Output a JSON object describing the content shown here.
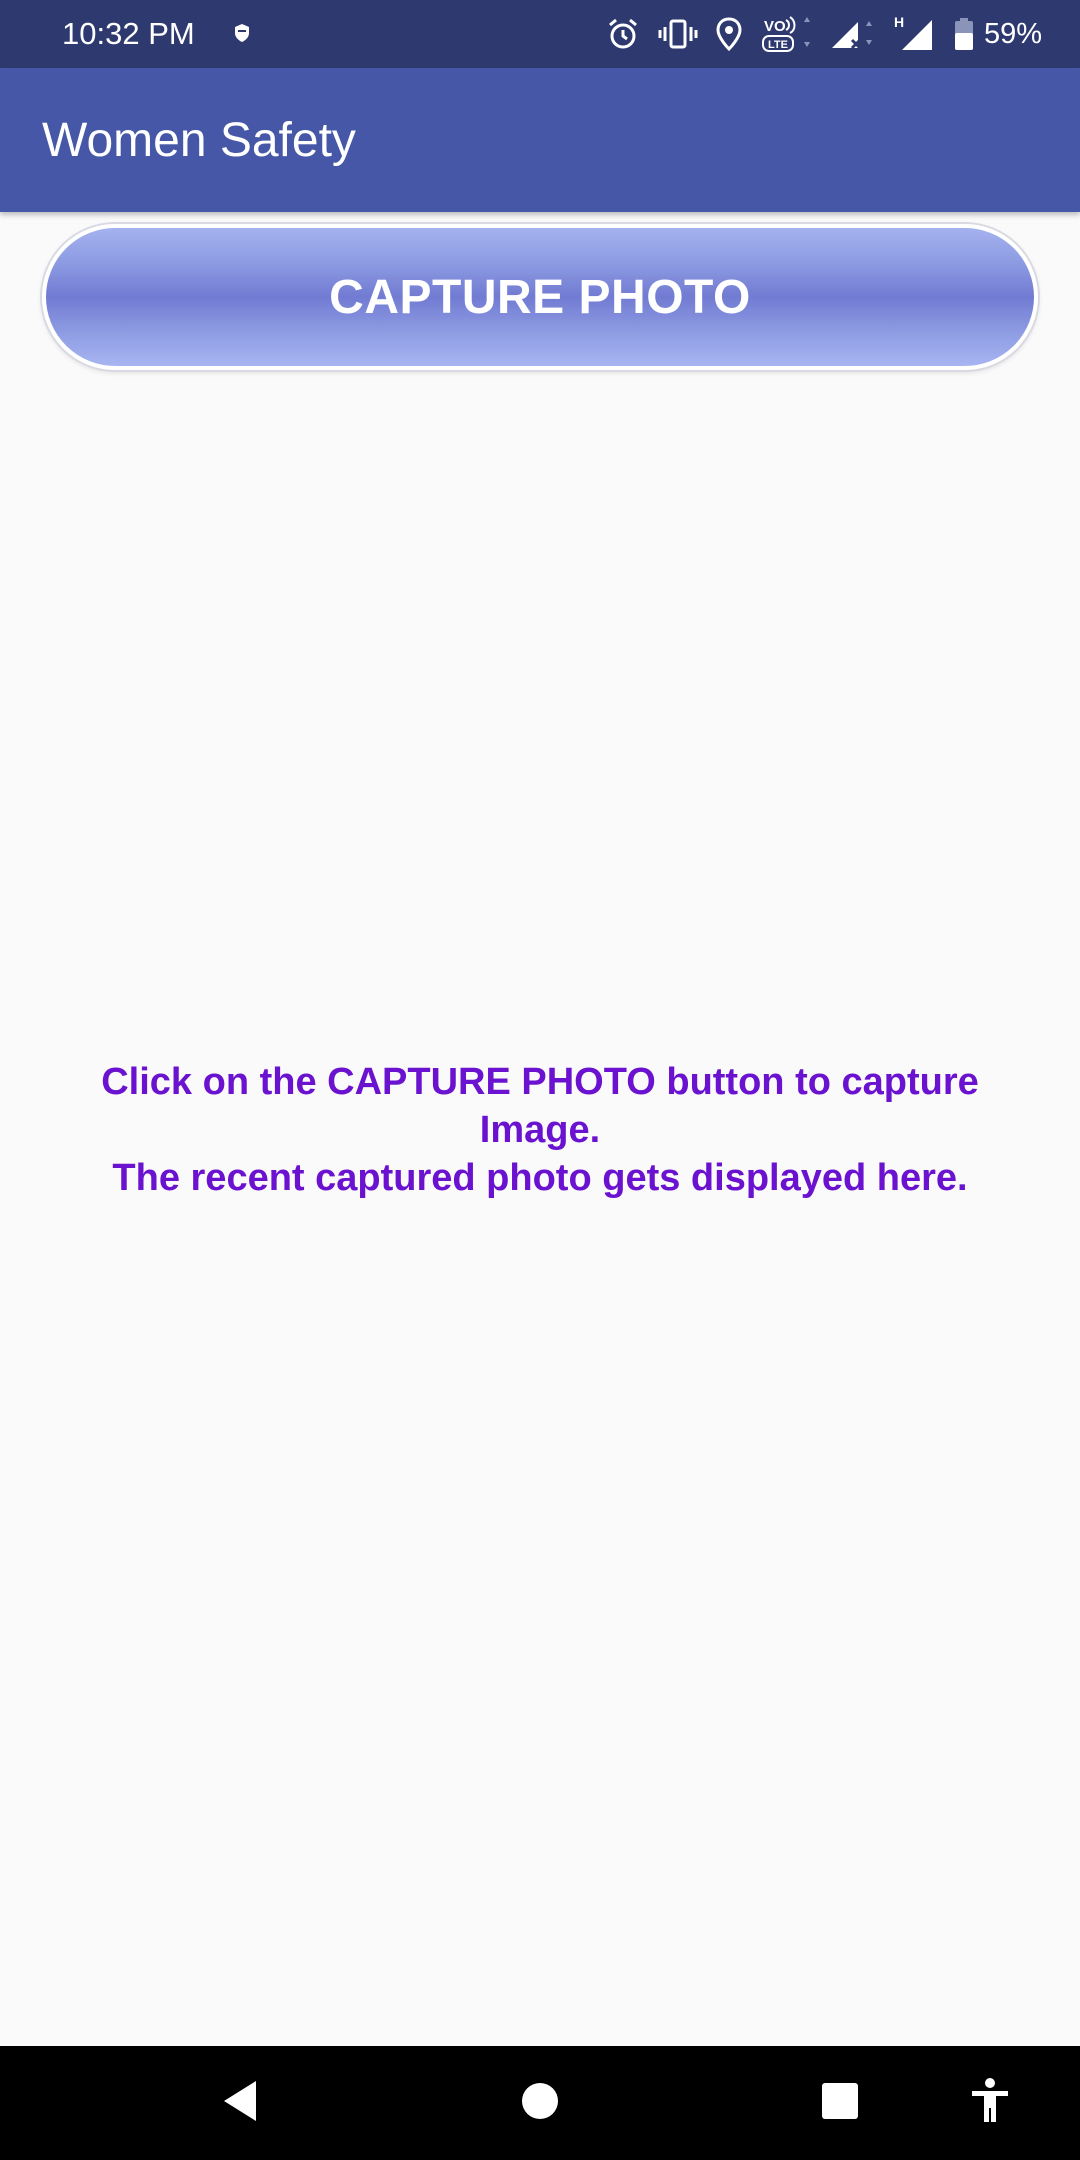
{
  "status_bar": {
    "time": "10:32 PM",
    "battery_percent": "59%",
    "icons": [
      "shield-notification-icon",
      "alarm-icon",
      "vibrate-icon",
      "location-icon",
      "volte-icon",
      "signal-no-data-icon",
      "signal-h-icon",
      "battery-icon"
    ],
    "network_type": "H",
    "volte_label": "VO LTE"
  },
  "app_bar": {
    "title": "Women Safety"
  },
  "capture_button": {
    "label": "CAPTURE PHOTO"
  },
  "instructions": {
    "line1": "Click on the CAPTURE PHOTO button to capture Image.",
    "line2": "The recent captured photo gets displayed here."
  },
  "nav_bar": {
    "buttons": [
      "back-icon",
      "home-icon",
      "recents-icon",
      "accessibility-icon"
    ]
  },
  "colors": {
    "status_bar": "#2e3a6f",
    "app_bar": "#4557a6",
    "button_gradient_mid": "#717bd2",
    "instruction_text": "#6a12cf",
    "background": "#fafafa"
  }
}
